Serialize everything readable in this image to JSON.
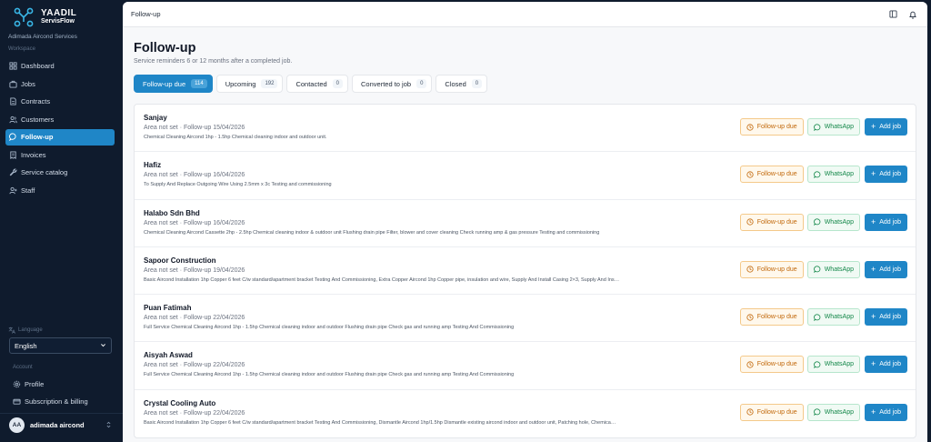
{
  "brand": {
    "name": "YAADIL",
    "sub": "ServisFlow"
  },
  "org": "Adimada Aircond Services",
  "sidebar": {
    "workspace_label": "Workspace",
    "items": [
      {
        "label": "Dashboard",
        "icon": "grid-icon"
      },
      {
        "label": "Jobs",
        "icon": "briefcase-icon"
      },
      {
        "label": "Contracts",
        "icon": "document-icon"
      },
      {
        "label": "Customers",
        "icon": "users-icon"
      },
      {
        "label": "Follow-up",
        "icon": "chat-icon"
      },
      {
        "label": "Invoices",
        "icon": "receipt-icon"
      },
      {
        "label": "Service catalog",
        "icon": "wrench-icon"
      },
      {
        "label": "Staff",
        "icon": "user-plus-icon"
      }
    ],
    "language_label": "Language",
    "language_value": "English",
    "account_label": "Account",
    "profile_label": "Profile",
    "billing_label": "Subscription & billing",
    "user": {
      "initials": "AA",
      "name": "adimada aircond"
    }
  },
  "topbar": {
    "title": "Follow-up"
  },
  "page": {
    "title": "Follow-up",
    "subtitle": "Service reminders 6 or 12 months after a completed job."
  },
  "tabs": [
    {
      "label": "Follow-up due",
      "count": "114"
    },
    {
      "label": "Upcoming",
      "count": "192"
    },
    {
      "label": "Contacted",
      "count": "0"
    },
    {
      "label": "Converted to job",
      "count": "0"
    },
    {
      "label": "Closed",
      "count": "0"
    }
  ],
  "actions": {
    "status_label": "Follow-up due",
    "whatsapp_label": "WhatsApp",
    "add_job_label": "Add job"
  },
  "rows": [
    {
      "name": "Sanjay",
      "meta": "Area not set · Follow-up 15/04/2026",
      "desc": "Chemical Cleaning Aircond 1hp - 1.5hp Chemical cleaning indoor and outdoor unit."
    },
    {
      "name": "Hafiz",
      "meta": "Area not set · Follow-up 16/04/2026",
      "desc": "To Supply And Replace Outgoing Wire Using 2.5mm x 3c Testing and commissioning"
    },
    {
      "name": "Halabo Sdn Bhd",
      "meta": "Area not set · Follow-up 16/04/2026",
      "desc": "Chemical Cleaning Aircond Cassette 2hp - 2.5hp Chemical cleaning indoor & outdoor unit Flushing drain pipe Filter, blower and cover cleaning Check running amp & gas pressure Testing and commissioning"
    },
    {
      "name": "Sapoor Construction",
      "meta": "Area not set · Follow-up 19/04/2026",
      "desc": "Basic Aircond Installation 1hp Copper 6 feet C/w standard/apartment bracket Testing And Commissioning, Extra Copper Aircond 1hp Copper pipe, insulation and wire, Supply And Install Casing 2×3, Supply And Ins…"
    },
    {
      "name": "Puan Fatimah",
      "meta": "Area not set · Follow-up 22/04/2026",
      "desc": "Full Service Chemical Cleaning Aircond 1hp - 1.5hp Chemical cleaning indoor and outdoor Flushing drain pipe Check gas and running amp Testing And Commissioning"
    },
    {
      "name": "Aisyah Aswad",
      "meta": "Area not set · Follow-up 22/04/2026",
      "desc": "Full Service Chemical Cleaning Aircond 1hp - 1.5hp Chemical cleaning indoor and outdoor Flushing drain pipe Check gas and running amp Testing And Commissioning"
    },
    {
      "name": "Crystal Cooling Auto",
      "meta": "Area not set · Follow-up 22/04/2026",
      "desc": "Basic Aircond Installation 1hp Copper 6 feet C/w standard/apartment bracket Testing And Commissioning, Dismantle Aircond 1hp/1.5hp Dismantle existing aircond indoor and outdoor unit, Patching hole, Chemica…"
    }
  ]
}
